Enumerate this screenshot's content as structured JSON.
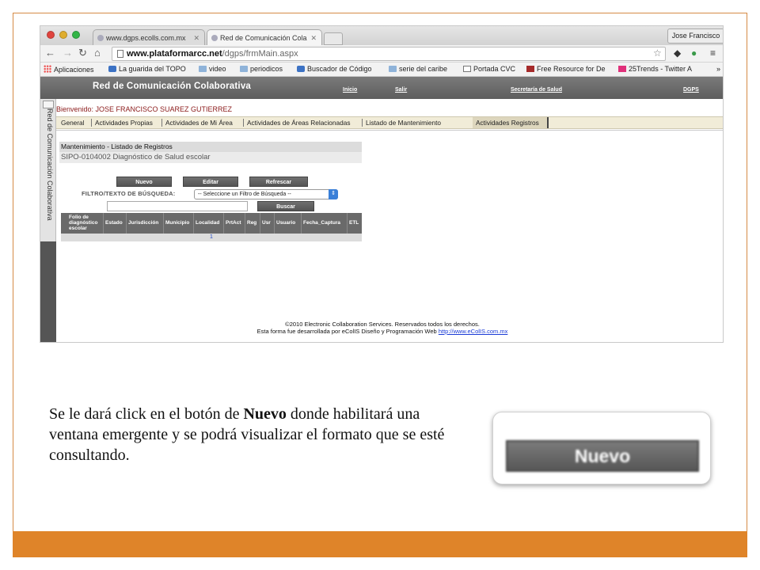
{
  "browser": {
    "tabs": [
      {
        "label": "www.dgps.ecolls.com.mx"
      },
      {
        "label": "Red de Comunicación Cola"
      }
    ],
    "profile_name": "Jose Francisco",
    "url": {
      "host": "www.plataformarcc.net",
      "path": "/dgps/frmMain.aspx"
    },
    "bookmarks": [
      {
        "label": "Aplicaciones"
      },
      {
        "label": "La guarida del TOPO"
      },
      {
        "label": "video"
      },
      {
        "label": "periodicos"
      },
      {
        "label": "Buscador de Código"
      },
      {
        "label": "serie del caribe"
      },
      {
        "label": "Portada CVC"
      },
      {
        "label": "Free Resource for De"
      },
      {
        "label": "25Trends - Twitter A"
      }
    ],
    "bookmarks_overflow": "»"
  },
  "app": {
    "title": "Red de Comunicación Colaborativa",
    "header_links": [
      {
        "label": "Inicio"
      },
      {
        "label": "Salir"
      },
      {
        "label": "Secretaría de Salud"
      },
      {
        "label": "DGPS"
      }
    ],
    "side_label": "Red de Comunicación Colaborativa",
    "welcome": "Bienvenido: JOSE FRANCISCO SUAREZ GUTIERREZ",
    "menu": [
      {
        "label": "General"
      },
      {
        "label": "Actividades Propias"
      },
      {
        "label": "Actividades de Mi Área"
      },
      {
        "label": "Actividades de Áreas Relacionadas"
      },
      {
        "label": "Listado de Mantenimiento"
      },
      {
        "label": "Actividades Registros"
      }
    ],
    "section_title": "Mantenimiento - Listado de Registros",
    "section_subtitle": "SIPO-0104002 Diagnóstico de Salud escolar",
    "buttons": {
      "new": "Nuevo",
      "edit": "Editar",
      "refresh": "Refrescar",
      "search": "Buscar"
    },
    "filter_label": "FILTRO/TEXTO DE BÚSQUEDA:",
    "filter_select": "-- Seleccione un Filtro de Búsqueda --",
    "grid": {
      "columns": [
        "Folio de diagnóstico escolar",
        "Estado",
        "Jurisdicción",
        "Municipio",
        "Localidad",
        "PrtAct",
        "Reg",
        "Usr",
        "Usuario",
        "Fecha_Captura",
        "ETL"
      ],
      "pager": "1"
    },
    "footer": {
      "line1": "©2010 Electronic Collaboration Services. Reservados todos los derechos.",
      "line2": "Esta forma fue desarrollada por eColIS Diseño y Programación Web",
      "link": "http://www.eColIS.com.mx"
    }
  },
  "slide": {
    "desc_before": "Se le dará click en el botón de ",
    "desc_bold": "Nuevo",
    "desc_after": " donde habilitará una ventana emergente y se podrá visualizar el formato que se esté consultando.",
    "zoom_button": "Nuevo",
    "accent_color": "#df8429"
  }
}
